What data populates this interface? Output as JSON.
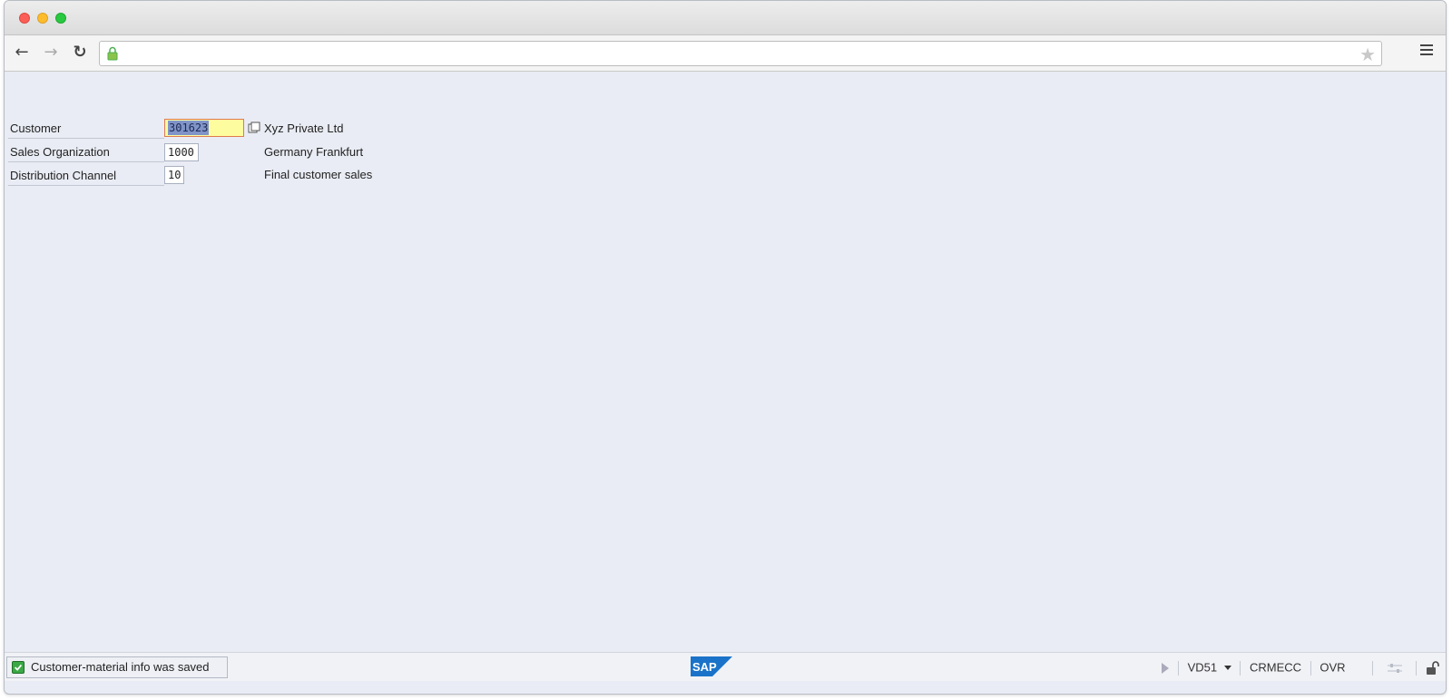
{
  "browser": {
    "address": "",
    "colors": {
      "close": "#fc5f57",
      "minimize": "#fdbc2e",
      "zoom": "#28c840"
    }
  },
  "form": {
    "customer": {
      "label": "Customer",
      "value": "301623",
      "description": "Xyz Private Ltd"
    },
    "sales_org": {
      "label": "Sales Organization",
      "value": "1000",
      "description": "Germany Frankfurt"
    },
    "dist_channel": {
      "label": "Distribution Channel",
      "value": "10",
      "description": "Final customer sales"
    }
  },
  "status": {
    "message": "Customer-material info was saved",
    "transaction": "VD51",
    "system": "CRMECC",
    "mode": "OVR",
    "logo": "SAP"
  }
}
